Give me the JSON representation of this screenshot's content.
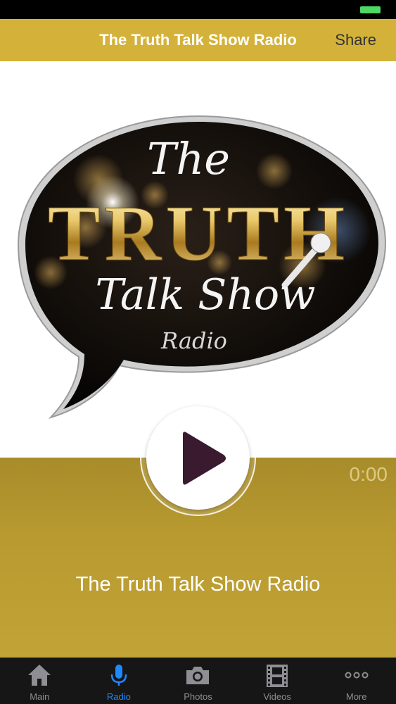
{
  "nav": {
    "title": "The Truth Talk Show Radio",
    "share_label": "Share"
  },
  "logo": {
    "text_the": "The",
    "text_truth": "TRUTH",
    "text_talk_show": "Talk Show",
    "text_radio": "Radio"
  },
  "player": {
    "time": "0:00",
    "station_name": "The Truth Talk Show Radio",
    "state": "paused"
  },
  "tabs": [
    {
      "label": "Main",
      "icon": "house-icon",
      "active": false
    },
    {
      "label": "Radio",
      "icon": "microphone-icon",
      "active": true
    },
    {
      "label": "Photos",
      "icon": "camera-icon",
      "active": false
    },
    {
      "label": "Videos",
      "icon": "film-icon",
      "active": false
    },
    {
      "label": "More",
      "icon": "more-dots-icon",
      "active": false
    }
  ],
  "colors": {
    "nav_bar": "#d4b23a",
    "player_bg": "#b89a30",
    "tab_active": "#1e88ff",
    "play_triangle": "#3a1a2e"
  }
}
